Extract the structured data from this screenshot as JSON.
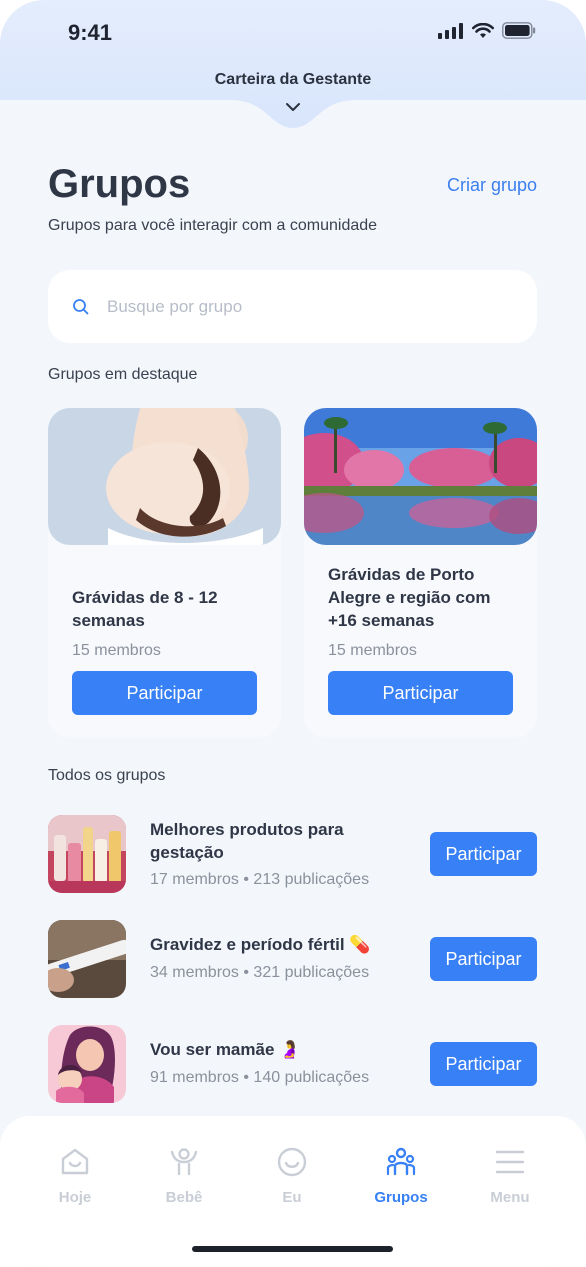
{
  "status_bar": {
    "time": "9:41"
  },
  "header": {
    "wallet_label": "Carteira da Gestante"
  },
  "page": {
    "title": "Grupos",
    "create_label": "Criar grupo",
    "subtitle": "Grupos para você interagir com a comunidade"
  },
  "search": {
    "placeholder": "Busque por grupo"
  },
  "featured": {
    "heading": "Grupos em destaque",
    "cards": [
      {
        "name": "Grávidas de 8 - 12 semanas",
        "members": "15 membros",
        "button": "Participar"
      },
      {
        "name": "Grávidas de Porto Alegre e região com +16 semanas",
        "members": "15 membros",
        "button": "Participar"
      }
    ]
  },
  "all_groups": {
    "heading": "Todos os grupos",
    "items": [
      {
        "name": "Melhores produtos para gestação",
        "members": "17 membros",
        "posts": "213 publicações",
        "button": "Participar"
      },
      {
        "name": "Gravidez e período fértil 💊",
        "members": "34 membros",
        "posts": "321 publicações",
        "button": "Participar"
      },
      {
        "name": "Vou ser mamãe 🤰",
        "members": "91 membros",
        "posts": "140 publicações",
        "button": "Participar"
      }
    ]
  },
  "tabs": [
    {
      "label": "Hoje",
      "icon": "home-icon"
    },
    {
      "label": "Bebê",
      "icon": "baby-icon"
    },
    {
      "label": "Eu",
      "icon": "smile-icon"
    },
    {
      "label": "Grupos",
      "icon": "groups-icon",
      "active": true
    },
    {
      "label": "Menu",
      "icon": "menu-icon"
    }
  ],
  "colors": {
    "accent": "#3880f5",
    "header_bg": "#dde9fc",
    "page_bg": "#f3f6fb"
  }
}
